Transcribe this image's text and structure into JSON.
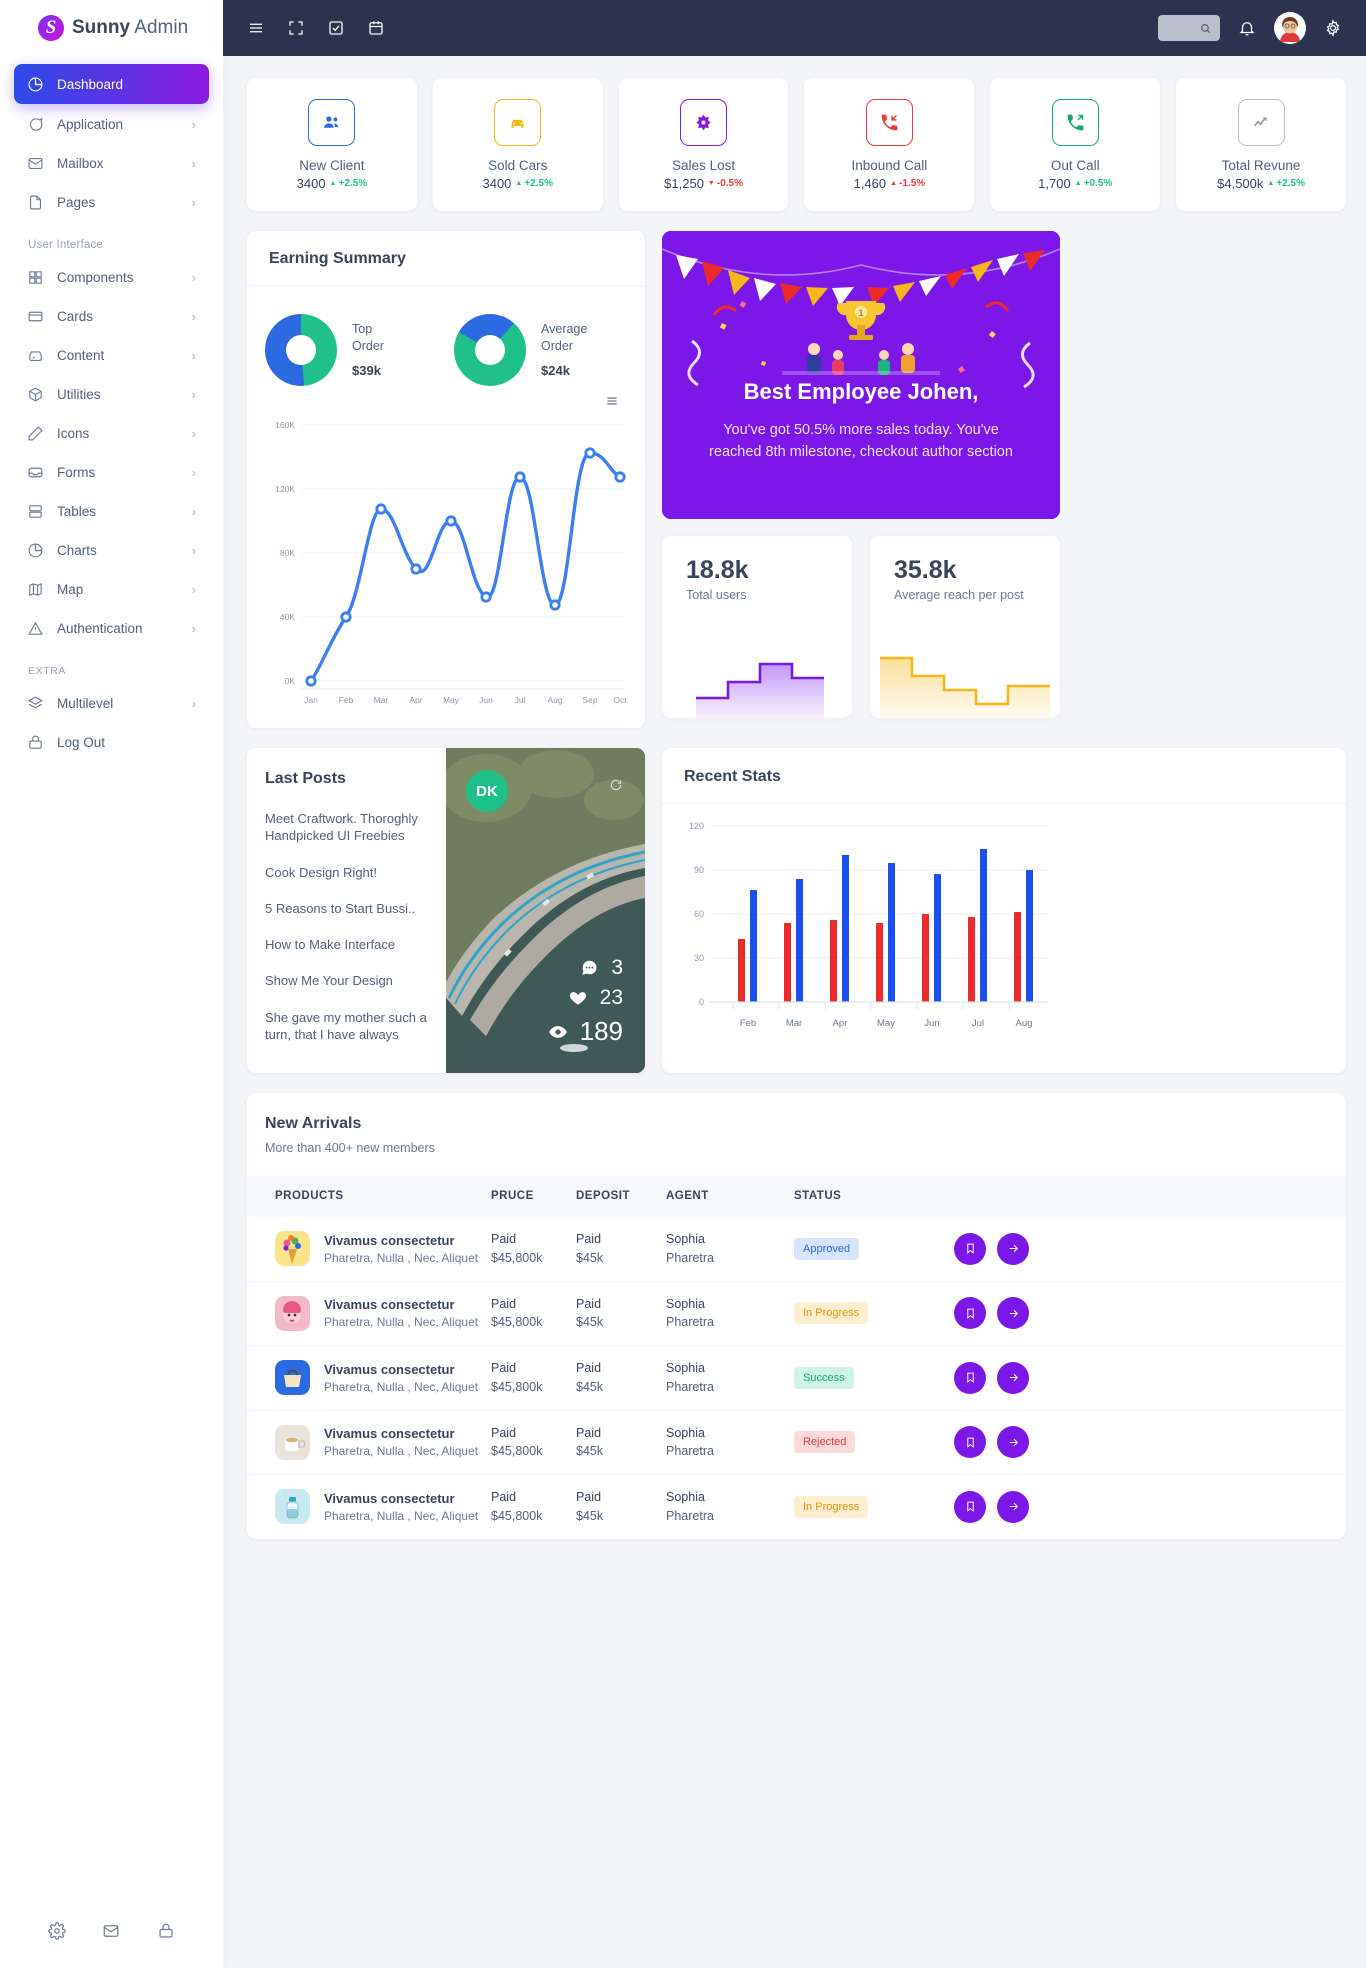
{
  "brand": {
    "mark": "S",
    "bold": "Sunny",
    "light": " Admin"
  },
  "sidebar": {
    "items": [
      {
        "label": "Dashboard",
        "icon": "pie-chart-icon",
        "active": true,
        "chevron": ""
      },
      {
        "label": "Application",
        "icon": "chat-icon",
        "active": false,
        "chevron": "›"
      },
      {
        "label": "Mailbox",
        "icon": "mail-icon",
        "active": false,
        "chevron": "›"
      },
      {
        "label": "Pages",
        "icon": "file-icon",
        "active": false,
        "chevron": "›"
      }
    ],
    "section_ui": "User Interface",
    "ui_items": [
      {
        "label": "Components",
        "icon": "grid-icon",
        "chevron": "›"
      },
      {
        "label": "Cards",
        "icon": "card-icon",
        "chevron": "›"
      },
      {
        "label": "Content",
        "icon": "box-icon",
        "chevron": "›"
      },
      {
        "label": "Utilities",
        "icon": "package-icon",
        "chevron": "›"
      },
      {
        "label": "Icons",
        "icon": "pencil-icon",
        "chevron": "›"
      },
      {
        "label": "Forms",
        "icon": "inbox-icon",
        "chevron": "›"
      },
      {
        "label": "Tables",
        "icon": "table-icon",
        "chevron": "›"
      },
      {
        "label": "Charts",
        "icon": "pie-chart-icon",
        "chevron": "›"
      },
      {
        "label": "Map",
        "icon": "map-icon",
        "chevron": "›"
      },
      {
        "label": "Authentication",
        "icon": "alert-icon",
        "chevron": "›"
      }
    ],
    "section_extra": "EXTRA",
    "extra_items": [
      {
        "label": "Multilevel",
        "icon": "layers-icon",
        "chevron": "›"
      },
      {
        "label": "Log Out",
        "icon": "lock-icon",
        "chevron": ""
      }
    ],
    "footer_icons": [
      "gear-icon",
      "envelope-icon",
      "lock-icon"
    ]
  },
  "topbar": {
    "icons": [
      "hamburger-icon",
      "fullscreen-icon",
      "task-icon",
      "calendar-icon"
    ],
    "search_placeholder": "",
    "right_icons": [
      "bell-icon",
      "avatar",
      "gear-icon"
    ]
  },
  "stats": [
    {
      "title": "New Client",
      "value": "3400",
      "delta": "+2.5%",
      "dir": "up",
      "color": "#2b6ae0",
      "icon": "users-icon"
    },
    {
      "title": "Sold Cars",
      "value": "3400",
      "delta": "+2.5%",
      "dir": "up",
      "color": "#f5b71a",
      "icon": "car-icon"
    },
    {
      "title": "Sales Lost",
      "value": "$1,250",
      "delta": "-0.5%",
      "dir": "down",
      "color": "#8b1ae0",
      "icon": "sales-icon"
    },
    {
      "title": "Inbound Call",
      "value": "1,460",
      "delta": "-1.5%",
      "dir": "downred",
      "color": "#ea3a3d",
      "icon": "phone-in-icon"
    },
    {
      "title": "Out Call",
      "value": "1,700",
      "delta": "+0.5%",
      "dir": "up",
      "color": "#16a97a",
      "icon": "phone-out-icon"
    },
    {
      "title": "Total Revune",
      "value": "$4,500k",
      "delta": "+2.5%",
      "dir": "up",
      "color": "#8d97ad",
      "icon": "trend-icon"
    }
  ],
  "earning": {
    "title": "Earning Summary",
    "donuts": [
      {
        "label_line1": "Top",
        "label_line2": "Order",
        "value": "$39k",
        "primary": "#1fc08a",
        "secondary": "#2b6ae0",
        "pct": 50
      },
      {
        "label_line1": "Average",
        "label_line2": "Order",
        "value": "$24k",
        "primary": "#1fc08a",
        "secondary": "#2b6ae0",
        "pct": 80
      }
    ],
    "menu_icon": "hamburger-menu-icon"
  },
  "chart_data": [
    {
      "type": "line",
      "title": "Earning Summary",
      "categories": [
        "Jan",
        "Feb",
        "Mar",
        "Apr",
        "May",
        "Jun",
        "Jul",
        "Aug",
        "Sep",
        "Oct"
      ],
      "values": [
        0,
        40000,
        110000,
        70000,
        100000,
        58000,
        127000,
        48000,
        136000,
        121000
      ],
      "ylabel": "",
      "xlabel": "",
      "yticks": [
        "0K",
        "40K",
        "80K",
        "120K",
        "160K"
      ],
      "ylim": [
        0,
        160000
      ],
      "grid": true,
      "legend": "none",
      "color": "#3b7ff0"
    },
    {
      "type": "bar",
      "title": "Recent Stats",
      "categories": [
        "Feb",
        "Mar",
        "Apr",
        "May",
        "Jun",
        "Jul",
        "Aug"
      ],
      "series": [
        {
          "name": "series-red",
          "values": [
            43,
            54,
            56,
            54,
            60,
            58,
            61
          ],
          "color": "#ee2b2b"
        },
        {
          "name": "series-blue",
          "values": [
            76,
            84,
            100,
            95,
            87,
            104,
            90
          ],
          "color": "#1a4ff0"
        }
      ],
      "yticks": [
        "0",
        "30",
        "60",
        "90",
        "120"
      ],
      "ylim": [
        0,
        120
      ],
      "grid": true
    },
    {
      "type": "area",
      "title": "Total users",
      "categories": [
        "1",
        "2",
        "3",
        "4",
        "5"
      ],
      "values": [
        18,
        30,
        44,
        68,
        55
      ],
      "color": "#7b18e8"
    },
    {
      "type": "area",
      "title": "Average reach per post",
      "categories": [
        "1",
        "2",
        "3",
        "4",
        "5"
      ],
      "values": [
        72,
        52,
        36,
        22,
        40
      ],
      "color": "#f5b71a"
    }
  ],
  "banner": {
    "title": "Best Employee Johen,",
    "text": "You've got 50.5% more sales today. You've reached 8th milestone, checkout author section"
  },
  "mini_cards": [
    {
      "number": "18.8k",
      "label": "Total users",
      "color": "#7b18e8"
    },
    {
      "number": "35.8k",
      "label": "Average reach per post",
      "color": "#f5b71a"
    }
  ],
  "last_posts": {
    "title": "Last Posts",
    "items": [
      "Meet Craftwork. Thoroghly Handpicked UI Freebies",
      "Cook Design Right!",
      "5 Reasons to Start Bussi..",
      "How to Make Interface",
      "Show Me Your Design",
      "She gave my mother such a turn, that I have always"
    ],
    "badge": "DK",
    "refresh_icon": "refresh-icon",
    "stats": [
      {
        "icon": "comment-icon",
        "value": "3"
      },
      {
        "icon": "heart-icon",
        "value": "23"
      },
      {
        "icon": "eye-icon",
        "value": "189"
      }
    ]
  },
  "recent_stats": {
    "title": "Recent Stats"
  },
  "arrivals": {
    "title": "New Arrivals",
    "subtitle": "More than 400+ new members",
    "columns": [
      "PRODUCTS",
      "PRUCE",
      "DEPOSIT",
      "AGENT",
      "STATUS",
      ""
    ],
    "rows": [
      {
        "name": "Vivamus consectetur",
        "desc": "Pharetra, Nulla , Nec, Aliquet",
        "price_top": "Paid",
        "price_bot": "$45,800k",
        "dep_top": "Paid",
        "dep_bot": "$45k",
        "agent_top": "Sophia",
        "agent_bot": "Pharetra",
        "status": "Approved",
        "status_class": "b-approved",
        "thumb": "#fbe38a"
      },
      {
        "name": "Vivamus consectetur",
        "desc": "Pharetra, Nulla , Nec, Aliquet",
        "price_top": "Paid",
        "price_bot": "$45,800k",
        "dep_top": "Paid",
        "dep_bot": "$45k",
        "agent_top": "Sophia",
        "agent_bot": "Pharetra",
        "status": "In Progress",
        "status_class": "b-progress",
        "thumb": "#f4b9c8"
      },
      {
        "name": "Vivamus consectetur",
        "desc": "Pharetra, Nulla , Nec, Aliquet",
        "price_top": "Paid",
        "price_bot": "$45,800k",
        "dep_top": "Paid",
        "dep_bot": "$45k",
        "agent_top": "Sophia",
        "agent_bot": "Pharetra",
        "status": "Success",
        "status_class": "b-success",
        "thumb": "#2b6ae0"
      },
      {
        "name": "Vivamus consectetur",
        "desc": "Pharetra, Nulla , Nec, Aliquet",
        "price_top": "Paid",
        "price_bot": "$45,800k",
        "dep_top": "Paid",
        "dep_bot": "$45k",
        "agent_top": "Sophia",
        "agent_bot": "Pharetra",
        "status": "Rejected",
        "status_class": "b-rejected",
        "thumb": "#e8e4dc"
      },
      {
        "name": "Vivamus consectetur",
        "desc": "Pharetra, Nulla , Nec, Aliquet",
        "price_top": "Paid",
        "price_bot": "$45,800k",
        "dep_top": "Paid",
        "dep_bot": "$45k",
        "agent_top": "Sophia",
        "agent_bot": "Pharetra",
        "status": "In Progress",
        "status_class": "b-progress",
        "thumb": "#c9e9f0"
      }
    ],
    "row_actions": [
      "bookmark-icon",
      "arrow-right-icon"
    ]
  }
}
